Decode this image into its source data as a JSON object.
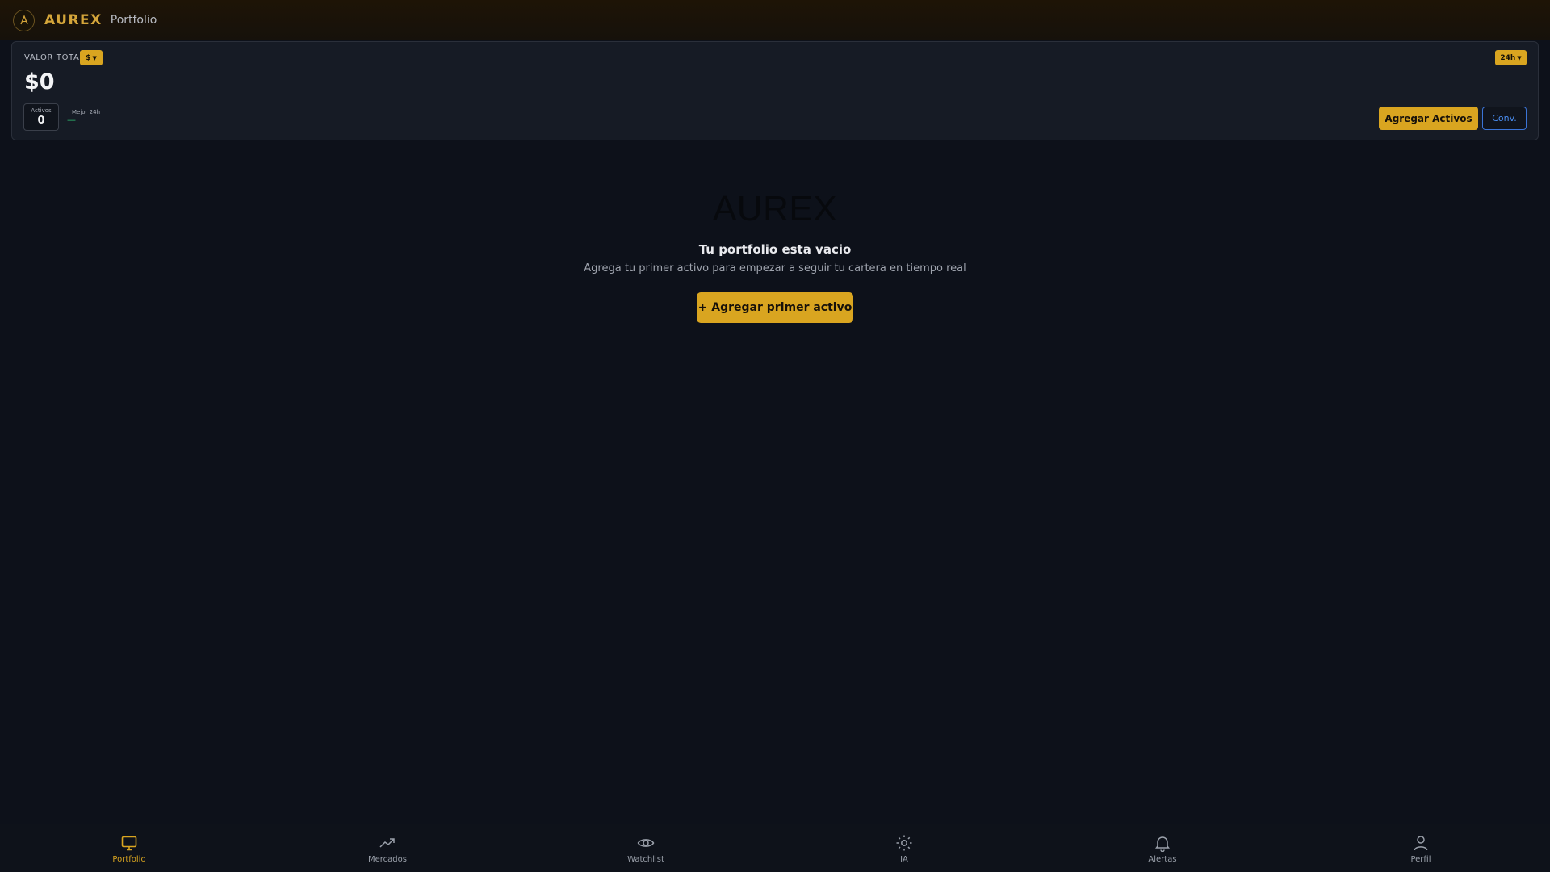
{
  "header": {
    "brand": "AUREX",
    "page": "Portfolio"
  },
  "summary": {
    "label": "VALOR TOTAL",
    "currency": "$",
    "period": "24h",
    "total": "$0",
    "assets_label": "Activos",
    "assets_value": "0",
    "best_label": "Mejor 24h",
    "best_value": "—",
    "add_button": "Agregar Activos",
    "conv_button": "Conv."
  },
  "empty_state": {
    "logo_text": "AUREX",
    "title": "Tu portfolio esta vacio",
    "subtitle": "Agrega tu primer activo para empezar a seguir tu cartera en tiempo real",
    "button": "+ Agregar primer activo"
  },
  "nav": {
    "items": [
      {
        "label": "Portfolio",
        "icon": "monitor-icon",
        "active": true
      },
      {
        "label": "Mercados",
        "icon": "trending-up-icon",
        "active": false
      },
      {
        "label": "Watchlist",
        "icon": "eye-icon",
        "active": false
      },
      {
        "label": "IA",
        "icon": "sun-icon",
        "active": false
      },
      {
        "label": "Alertas",
        "icon": "bell-icon",
        "active": false
      },
      {
        "label": "Perfil",
        "icon": "user-icon",
        "active": false
      }
    ]
  },
  "colors": {
    "accent": "#d9a520",
    "background": "#0d111a",
    "positive": "#2fbf71",
    "link": "#4a8df0"
  }
}
